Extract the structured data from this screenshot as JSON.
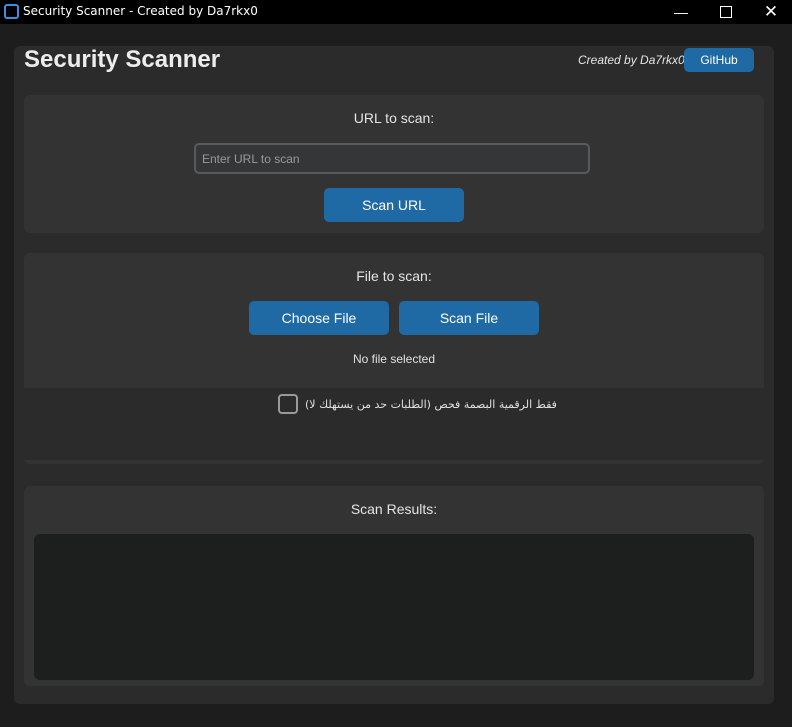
{
  "window": {
    "title": "Security Scanner - Created by Da7rkx0",
    "controls": {
      "minimize": "—",
      "close": "✕"
    }
  },
  "header": {
    "title": "Security Scanner",
    "credit": "Created by Da7rkx0",
    "github_label": "GitHub"
  },
  "url_section": {
    "label": "URL to scan:",
    "input_placeholder": "Enter URL to scan",
    "input_value": "",
    "scan_button": "Scan URL"
  },
  "file_section": {
    "label": "File to scan:",
    "choose_button": "Choose File",
    "scan_button": "Scan File",
    "status": "No file selected",
    "checkbox_label": "(الطلبات حد من يستهلك لا) فقط الرقمية البصمة فحص",
    "checkbox_checked": false
  },
  "results_section": {
    "label": "Scan Results:",
    "content": ""
  },
  "colors": {
    "accent": "#1f6aa5",
    "background": "#1d1d1d",
    "panel": "#333333"
  }
}
